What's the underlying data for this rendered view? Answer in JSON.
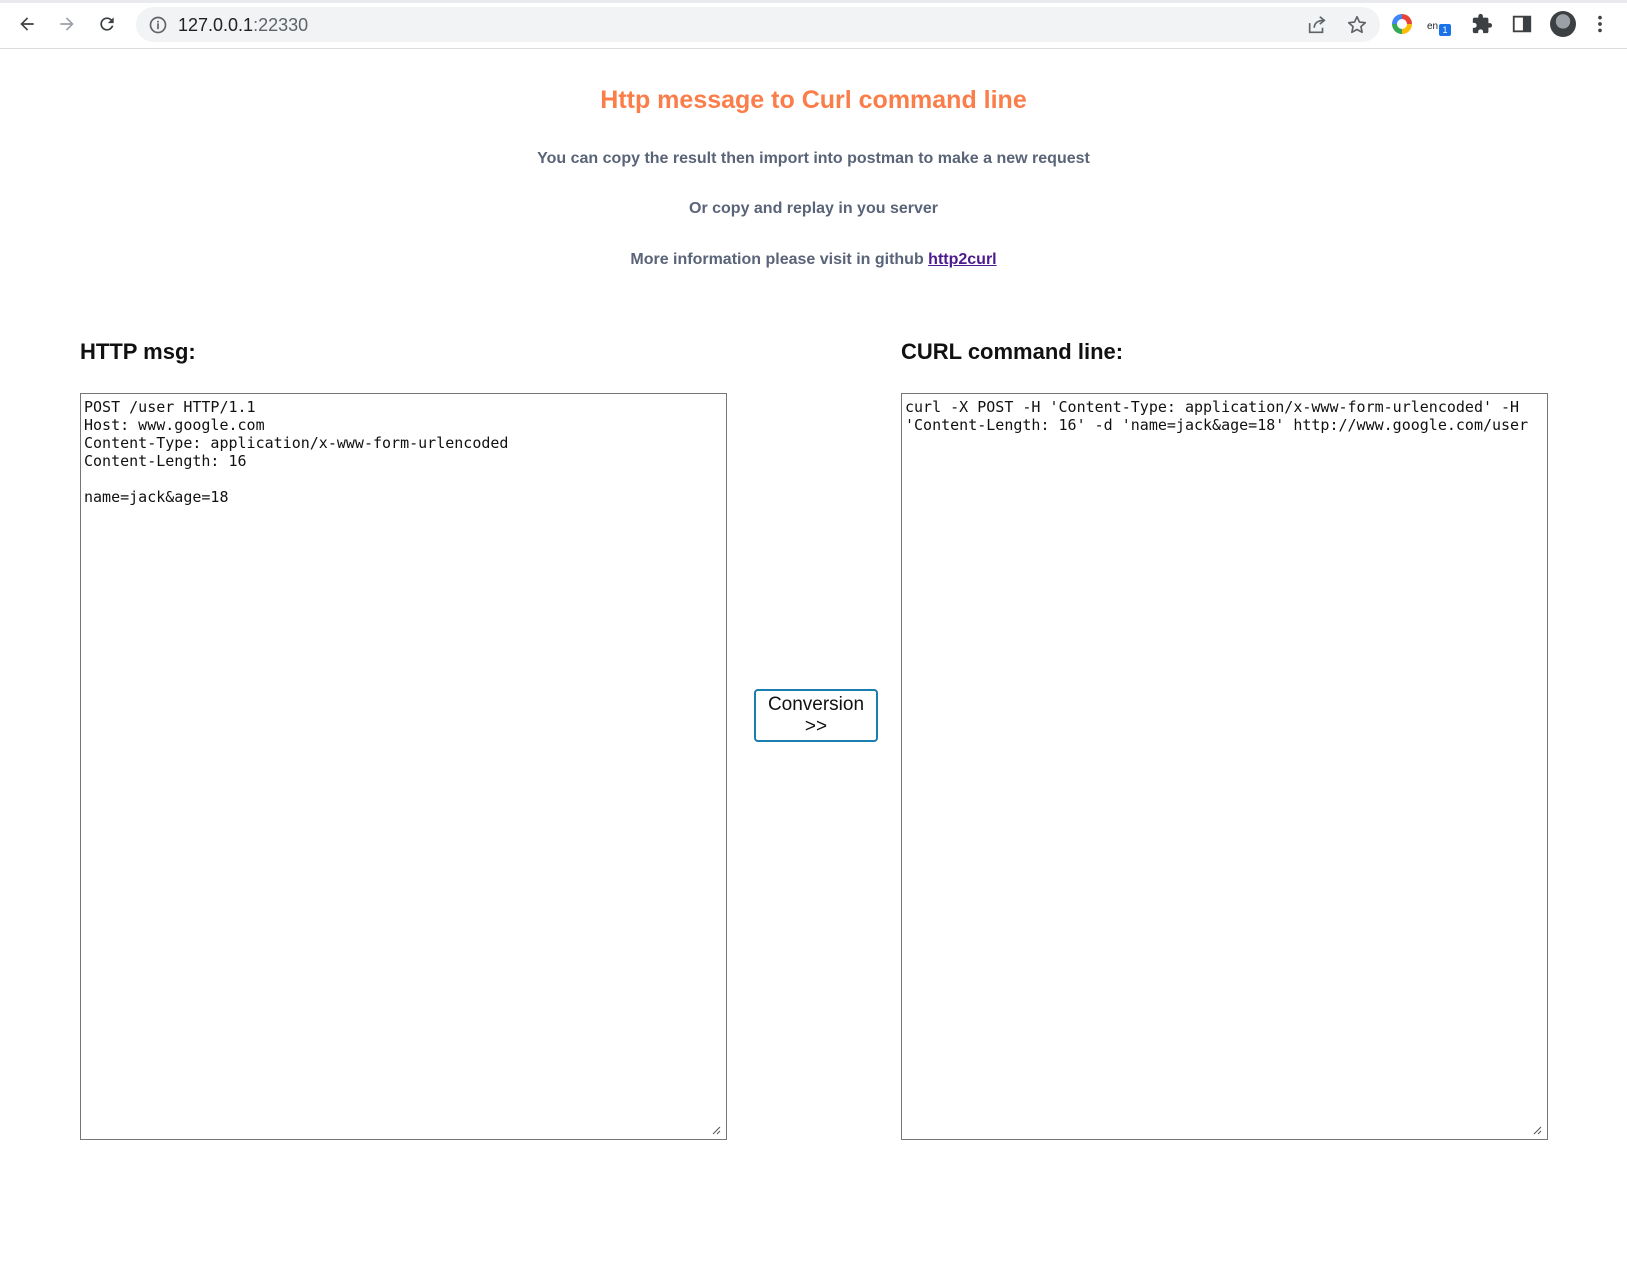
{
  "browser": {
    "url_host": "127.0.0.1",
    "url_port": ":22330",
    "extensions": [
      {
        "name": "google-color-extension"
      },
      {
        "name": "translate-extension",
        "label": "en",
        "badge": "1"
      }
    ]
  },
  "page": {
    "title": "Http message to Curl command line",
    "line1": "You can copy the result then import into postman to make a new request",
    "line2": "Or copy and replay in you server",
    "line3_prefix": "More information please visit in github ",
    "line3_link": "http2curl"
  },
  "http_pane": {
    "label": "HTTP msg:",
    "content": "POST /user HTTP/1.1\nHost: www.google.com\nContent-Type: application/x-www-form-urlencoded\nContent-Length: 16\n\nname=jack&age=18"
  },
  "convert_button": {
    "label": "Conversion\n>>"
  },
  "curl_pane": {
    "label": "CURL command line:",
    "content": "curl -X POST -H 'Content-Type: application/x-www-form-urlencoded' -H 'Content-Length: 16' -d 'name=jack&age=18' http://www.google.com/user"
  }
}
